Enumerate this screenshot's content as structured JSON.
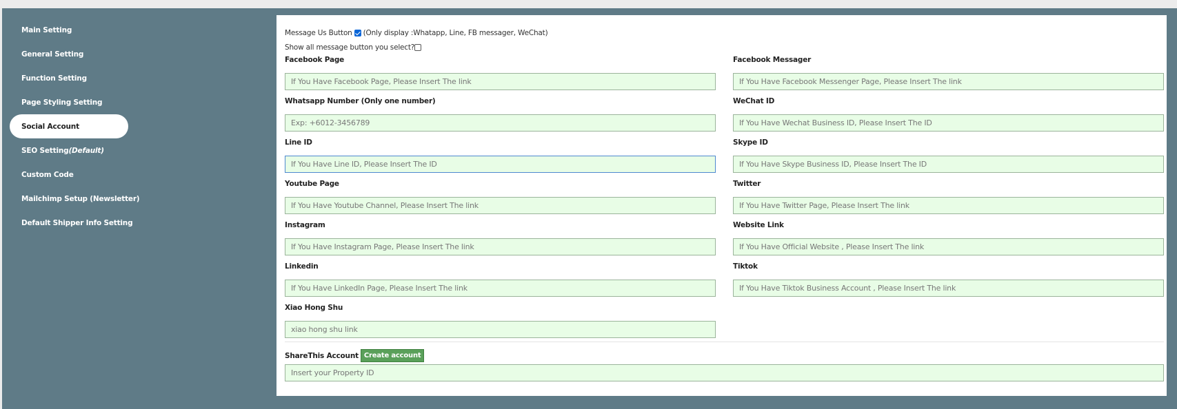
{
  "sidebar": {
    "items": [
      {
        "label": "Main Setting"
      },
      {
        "label": "General Setting"
      },
      {
        "label": "Function Setting"
      },
      {
        "label": "Page Styling Setting"
      },
      {
        "label": "Social Account",
        "active": true
      },
      {
        "label": "SEO Setting",
        "suffix": "(Default)"
      },
      {
        "label": "Custom Code"
      },
      {
        "label": "Mailchimp Setup (Newsletter)"
      },
      {
        "label": "Default Shipper Info Setting"
      }
    ]
  },
  "options": {
    "message_us_label": "Message Us Button",
    "message_us_checked": true,
    "message_us_note": "(Only display :Whatapp, Line, FB messager, WeChat)",
    "show_all_label": "Show all message button you select?",
    "show_all_checked": false
  },
  "fields": {
    "facebook_page": {
      "label": "Facebook Page",
      "placeholder": "If You Have Facebook Page, Please Insert The link"
    },
    "facebook_messager": {
      "label": "Facebook Messager",
      "placeholder": "If You Have Facebook Messenger Page, Please Insert The link"
    },
    "whatsapp": {
      "label": "Whatsapp Number (Only one number)",
      "placeholder": "Exp: +6012-3456789"
    },
    "wechat": {
      "label": "WeChat ID",
      "placeholder": "If You Have Wechat Business ID, Please Insert The ID"
    },
    "line": {
      "label": "Line ID",
      "placeholder": "If You Have Line ID, Please Insert The ID"
    },
    "skype": {
      "label": "Skype ID",
      "placeholder": "If You Have Skype Business ID, Please Insert The ID"
    },
    "youtube": {
      "label": "Youtube Page",
      "placeholder": "If You Have Youtube Channel, Please Insert The link"
    },
    "twitter": {
      "label": "Twitter",
      "placeholder": "If You Have Twitter Page, Please Insert The link"
    },
    "instagram": {
      "label": "Instagram",
      "placeholder": "If You Have Instagram Page, Please Insert The link"
    },
    "website": {
      "label": "Website Link",
      "placeholder": "If You Have Official Website , Please Insert The link"
    },
    "linkedin": {
      "label": "Linkedin",
      "placeholder": "If You Have LinkedIn Page, Please Insert The link"
    },
    "tiktok": {
      "label": "Tiktok",
      "placeholder": "If You Have Tiktok Business Account , Please Insert The link"
    },
    "xiaohongshu": {
      "label": "Xiao Hong Shu",
      "placeholder": "xiao hong shu link"
    }
  },
  "sharethis": {
    "label": "ShareThis Account",
    "button_label": "Create account",
    "placeholder": "Insert your Property ID"
  },
  "colors": {
    "sidebar_bg": "#5f7b87",
    "input_bg": "#e8fde6",
    "button_green": "#5aa05a"
  }
}
